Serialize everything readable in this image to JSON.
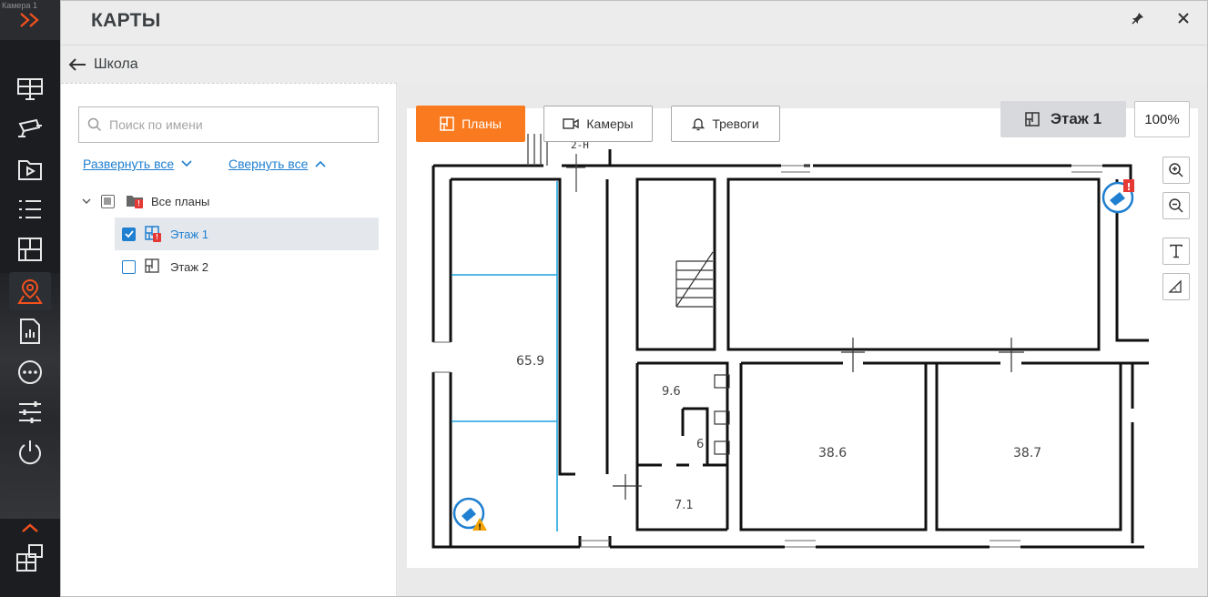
{
  "sidebar": {
    "camera_label": "Камера 1",
    "icons": [
      "chevrons-right-icon",
      "monitor-icon",
      "camera-icon",
      "video-archive-icon",
      "event-list-icon",
      "layout-grid-icon",
      "map-pin-icon",
      "report-icon",
      "more-icon",
      "settings-sliders-icon",
      "power-icon",
      "chevron-up-icon",
      "layouts-icon"
    ],
    "active_item": "map-pin-icon",
    "accent_color": "#f4511e"
  },
  "window": {
    "title": "КАРТЫ",
    "back_label": "Школа"
  },
  "tree": {
    "search_placeholder": "Поиск по имени",
    "expand_all": "Развернуть все",
    "collapse_all": "Свернуть все",
    "items": [
      {
        "label": "Все планы",
        "state": "partial",
        "alert": true
      },
      {
        "label": "Этаж 1",
        "state": "checked",
        "alert": true,
        "selected": true
      },
      {
        "label": "Этаж 2",
        "state": "unchecked",
        "alert": false
      }
    ]
  },
  "map": {
    "tabs": [
      {
        "label": "Планы",
        "active": true
      },
      {
        "label": "Камеры",
        "active": false
      },
      {
        "label": "Тревоги",
        "active": false
      }
    ],
    "floor_name": "Этаж 1",
    "zoom": "100%",
    "room_labels": {
      "stair_label": "2-Н",
      "r1": "65.9",
      "r2": "9.6",
      "r3": "6",
      "r4": "7.1",
      "r5": "38.6",
      "r6": "38.7"
    },
    "tools": [
      "zoom-in-icon",
      "zoom-out-icon",
      "text-tool-icon",
      "measure-tool-icon"
    ],
    "colors": {
      "active_tab": "#f97a1f",
      "camera_marker": "#1f7fd0",
      "alarm": "#e53935",
      "warning": "#f4a300"
    }
  }
}
